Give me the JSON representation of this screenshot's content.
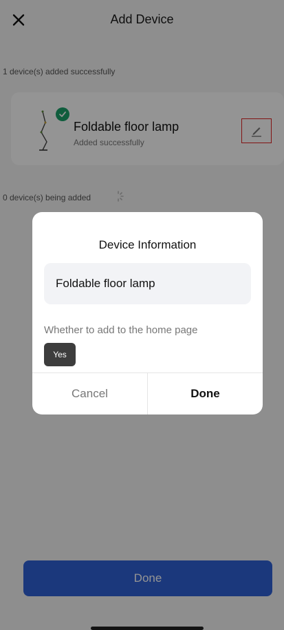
{
  "header": {
    "title": "Add Device",
    "close_icon": "close-icon"
  },
  "added": {
    "label": "1 device(s) added successfully",
    "device": {
      "name": "Foldable floor lamp",
      "status": "Added successfully",
      "edit_icon": "pencil-icon"
    }
  },
  "adding": {
    "label": "0 device(s) being added"
  },
  "dialog": {
    "title": "Device Information",
    "name_value": "Foldable floor lamp",
    "home_question": "Whether to add to the home page",
    "home_option": "Yes",
    "cancel_label": "Cancel",
    "done_label": "Done"
  },
  "footer": {
    "done_label": "Done"
  },
  "colors": {
    "success": "#1aa06a",
    "primary": "#2f61d6",
    "highlight": "#e02020"
  }
}
